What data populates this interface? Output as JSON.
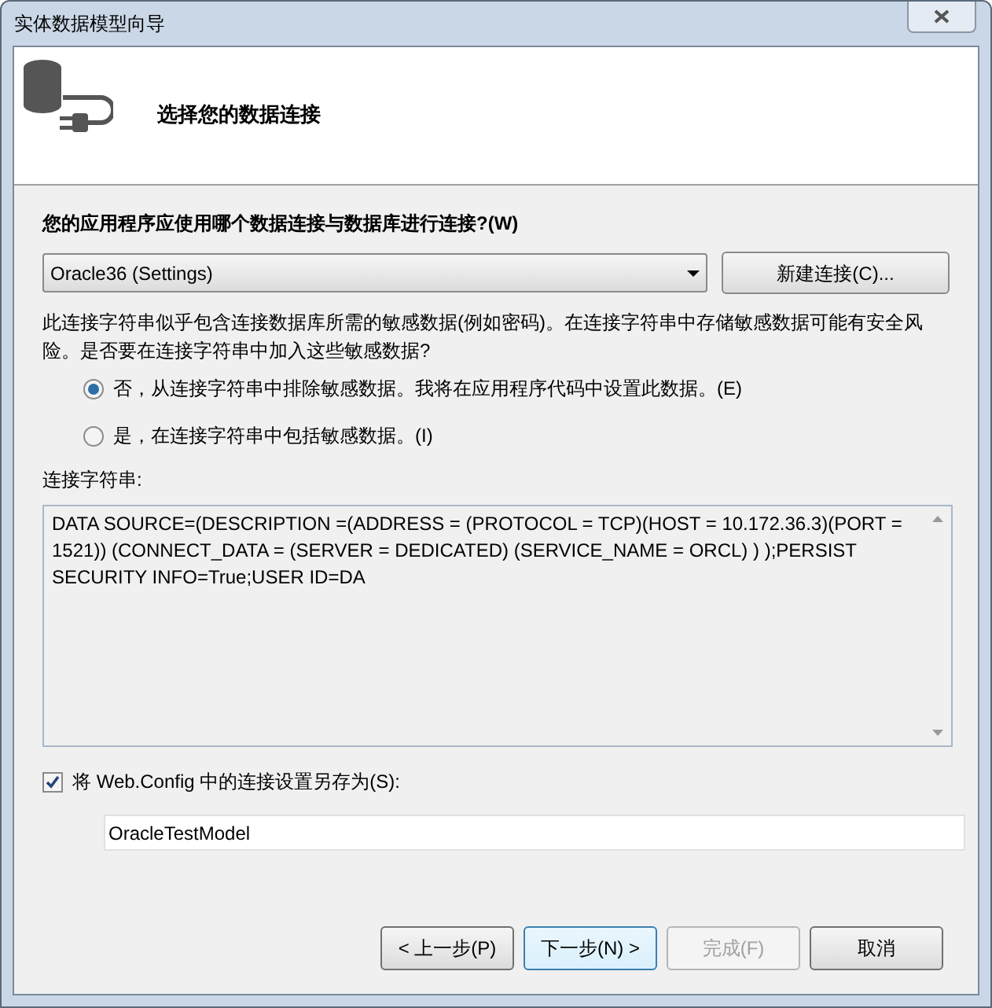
{
  "window": {
    "title": "实体数据模型向导"
  },
  "header": {
    "title": "选择您的数据连接"
  },
  "question": "您的应用程序应使用哪个数据连接与数据库进行连接?(W)",
  "connection_select": {
    "value": "Oracle36 (Settings)"
  },
  "new_connection_button": "新建连接(C)...",
  "warning": "此连接字符串似乎包含连接数据库所需的敏感数据(例如密码)。在连接字符串中存储敏感数据可能有安全风险。是否要在连接字符串中加入这些敏感数据?",
  "options": [
    {
      "label": "否，从连接字符串中排除敏感数据。我将在应用程序代码中设置此数据。(E)",
      "selected": true
    },
    {
      "label": "是，在连接字符串中包括敏感数据。(I)",
      "selected": false
    }
  ],
  "connection_string": {
    "label": "连接字符串:",
    "value": "DATA SOURCE=(DESCRIPTION =(ADDRESS = (PROTOCOL = TCP)(HOST = 10.172.36.3)(PORT = 1521)) (CONNECT_DATA = (SERVER = DEDICATED) (SERVICE_NAME = ORCL) )  );PERSIST SECURITY INFO=True;USER ID=DA"
  },
  "save_setting": {
    "label": "将 Web.Config 中的连接设置另存为(S):",
    "checked": true,
    "value": "OracleTestModel"
  },
  "buttons": [
    {
      "label": "< 上一步(P)",
      "disabled": false,
      "focused": false
    },
    {
      "label": "下一步(N) >",
      "disabled": false,
      "focused": true
    },
    {
      "label": "完成(F)",
      "disabled": true,
      "focused": false
    },
    {
      "label": "取消",
      "disabled": false,
      "focused": false
    }
  ]
}
